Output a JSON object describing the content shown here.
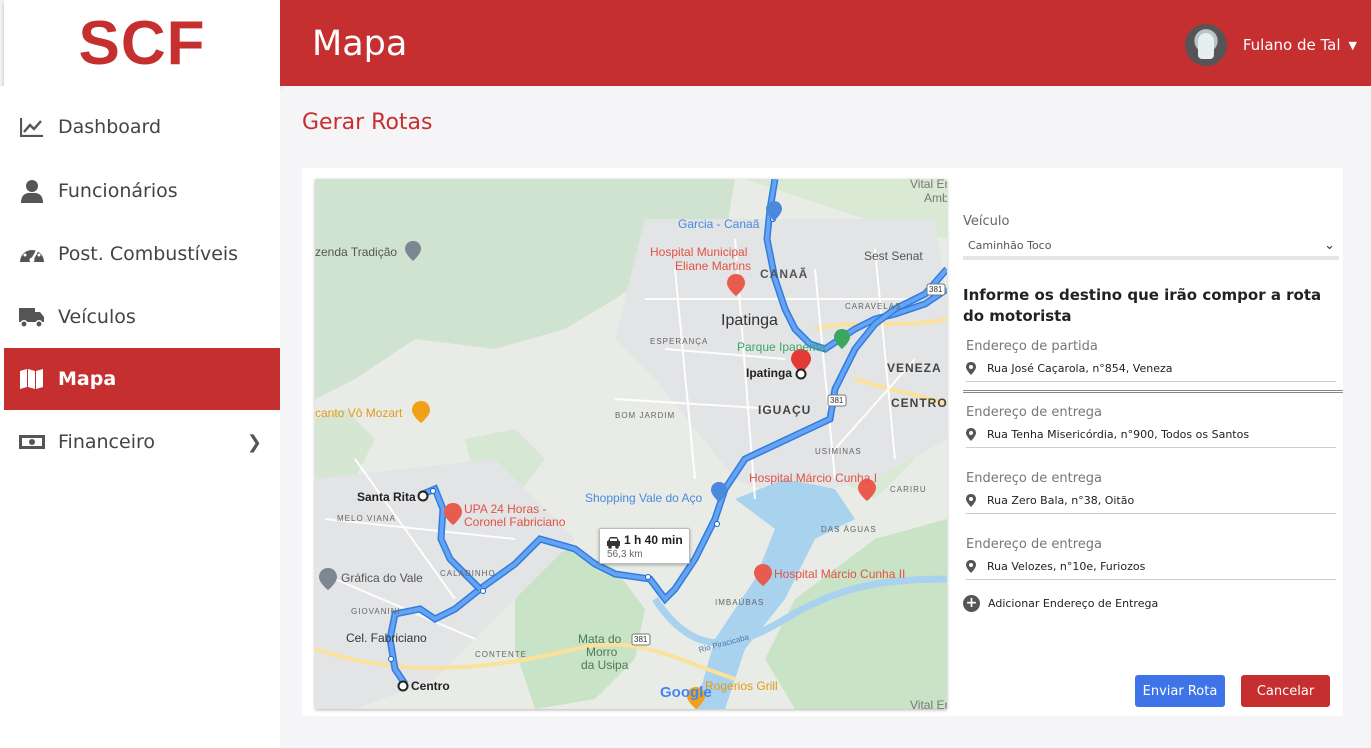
{
  "brand": {
    "logo": "SCF",
    "color": "#c62f2f"
  },
  "header": {
    "title": "Mapa",
    "user_name": "Fulano de Tal"
  },
  "sidebar": {
    "items": [
      {
        "label": "Dashboard",
        "icon": "chart-line-icon"
      },
      {
        "label": "Funcionários",
        "icon": "user-icon"
      },
      {
        "label": "Post. Combustíveis",
        "icon": "gauge-icon"
      },
      {
        "label": "Veículos",
        "icon": "truck-icon"
      },
      {
        "label": "Mapa",
        "icon": "map-icon",
        "active": true
      },
      {
        "label": "Financeiro",
        "icon": "money-icon",
        "has_submenu": true
      }
    ]
  },
  "main": {
    "title": "Gerar Rotas",
    "vehicle": {
      "label": "Veículo",
      "selected": "Caminhão Toco"
    },
    "instructions": "Informe os destino que irão compor a rota do motorista",
    "start": {
      "label": "Endereço de partida",
      "value": "Rua José Caçarola, n°854, Veneza"
    },
    "deliveries": [
      {
        "label": "Endereço de entrega",
        "value": "Rua Tenha Misericórdia, n°900, Todos os Santos"
      },
      {
        "label": "Endereço de entrega",
        "value": "Rua Zero Bala, n°38, Oitão"
      },
      {
        "label": "Endereço de entrega",
        "value": "Rua Velozes, n°10e, Furiozos"
      }
    ],
    "add_delivery": "Adicionar Endereço de Entrega",
    "send_button": "Enviar Rota",
    "cancel_button": "Cancelar"
  },
  "map": {
    "route_time": "1 h 40 min",
    "route_distance": "56,3 km",
    "labels": {
      "vital_top": "Vital Er",
      "amb": "Amb",
      "garcia": "Garcia - Canaã",
      "hospital_municipal": "Hospital Municipal",
      "eliane": "Eliane Martins",
      "canaa": "CANAÃ",
      "fazenda": "zenda Tradição",
      "sest": "Sest Senat",
      "caravelas": "CARAVELAS",
      "ipatinga_city": "Ipatinga",
      "esperanca": "ESPERANÇA",
      "parque": "Parque Ipanema",
      "veneza": "VENEZA",
      "ipatinga_marker": "Ipatinga",
      "recanto": "canto Vô Mozart",
      "bom_jardim": "BOM JARDIM",
      "iguacu": "IGUAÇU",
      "centro_right": "CENTRO",
      "usiminas": "USIMINAS",
      "hosp_marcio": "Hospital Márcio Cunha I",
      "cariru": "CARIRU",
      "santa_rita": "Santa Rita",
      "upa1": "UPA 24 Horas -",
      "upa2": "Coronel Fabriciano",
      "melo_viana": "MELO VIANA",
      "shopping": "Shopping Vale do Aço",
      "das_aguas": "DAS ÁGUAS",
      "grafica": "Gráfica do Vale",
      "caladinho": "CALADINHO",
      "hosp_marcio2": "Hospital Márcio Cunha II",
      "giovanini": "GIOVANINI",
      "imbaubas": "IMBAÚBAS",
      "fabriciano": "Cel. Fabriciano",
      "mata1": "Mata do",
      "mata2": "Morro",
      "mata3": "da Usipa",
      "rio": "Rio Piracicaba",
      "contente": "CONTENTE",
      "centro_bottom": "Centro",
      "rogerios": "Rogerios Grill",
      "google": "Google",
      "vital_bottom": "Vital Er",
      "shield_381a": "381",
      "shield_381b": "381",
      "shield_381c": "381"
    }
  }
}
